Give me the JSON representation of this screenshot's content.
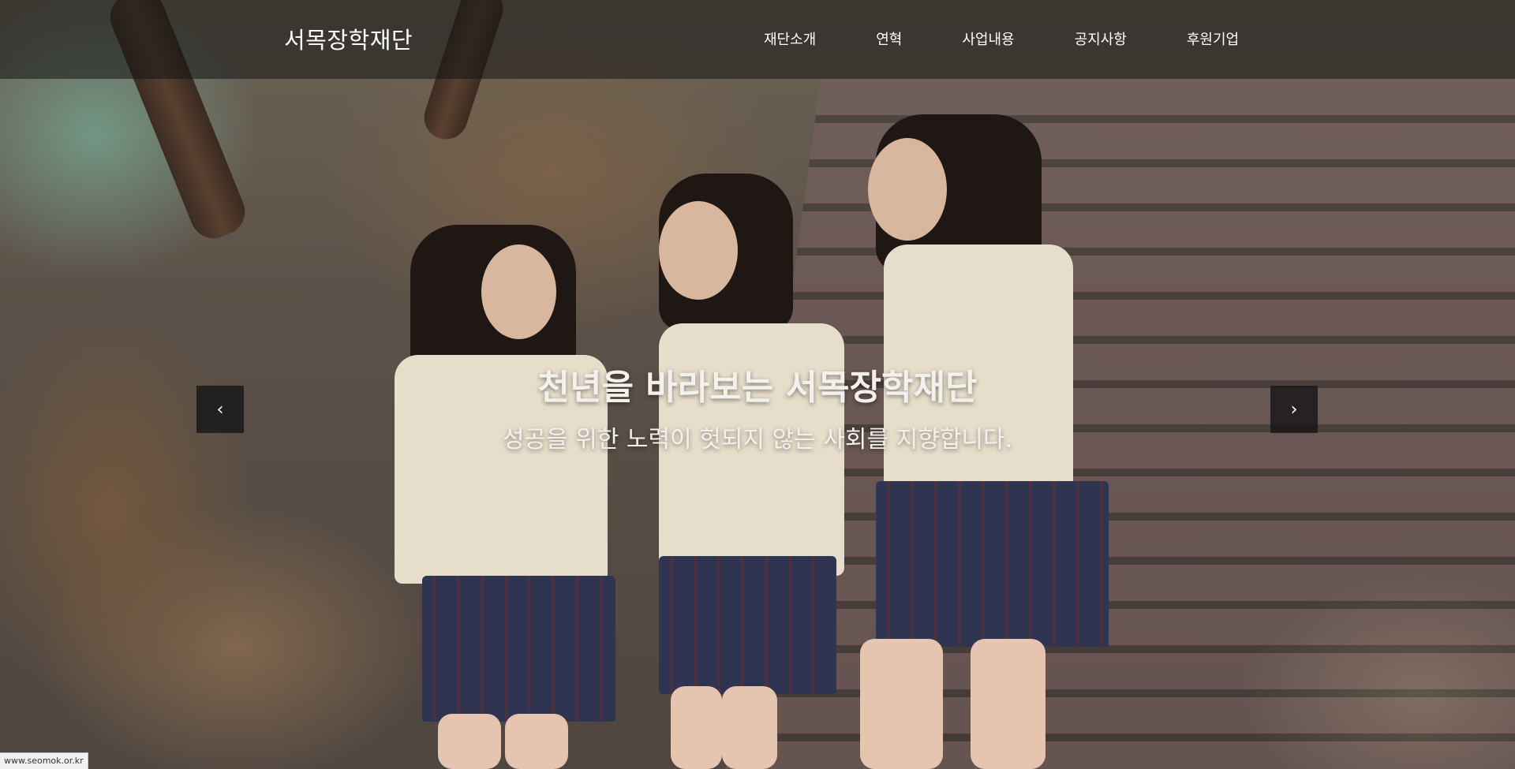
{
  "site": {
    "logo_text": "서목장학재단"
  },
  "nav": {
    "items": [
      {
        "label": "재단소개"
      },
      {
        "label": "연혁"
      },
      {
        "label": "사업내용"
      },
      {
        "label": "공지사항"
      },
      {
        "label": "후원기업"
      }
    ]
  },
  "hero": {
    "title": "천년을 바라보는 서목장학재단",
    "subtitle": "성공을 위한 노력이 헛되지 않는 사회를 지향합니다.",
    "prev_icon": "chevron-left-icon",
    "next_icon": "chevron-right-icon",
    "prev_glyph": "‹",
    "next_glyph": "›"
  },
  "status": {
    "url": "www.seomok.or.kr"
  },
  "colors": {
    "topbar_bg": "#141414",
    "text": "#ffffff",
    "arrow_bg": "#191919"
  }
}
